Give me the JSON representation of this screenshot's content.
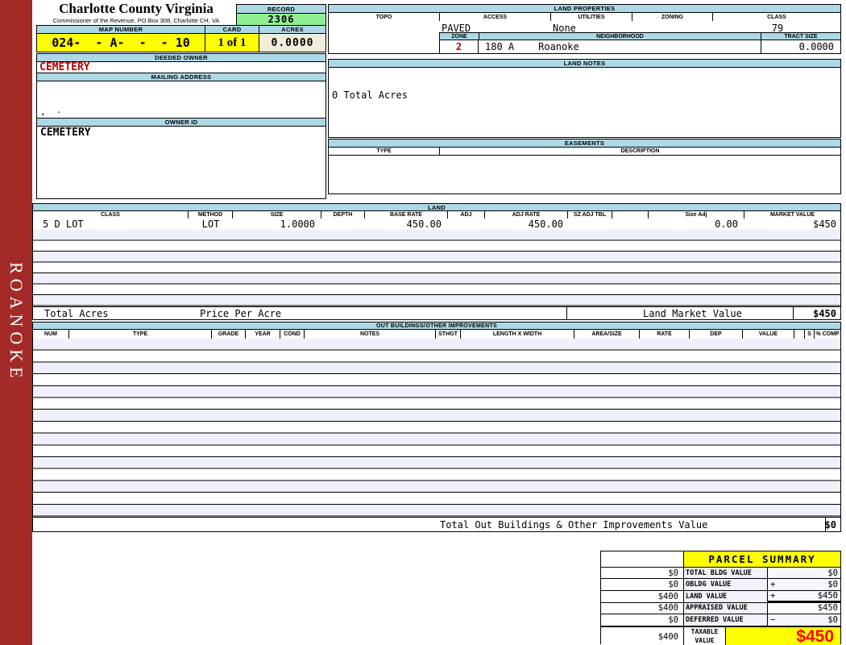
{
  "app": {
    "sidebar_label": "ROANOKE"
  },
  "header": {
    "title": "Charlotte County Virginia",
    "subtitle": "Commissioner of the Revenue, PO Box 308, Charlotte CH, VA",
    "record_label": "RECORD",
    "record_value": "2306",
    "map_number_label": "MAP NUMBER",
    "map_number_value": "024-  - A-  -  - 10",
    "card_label": "CARD",
    "card_value": "1 of 1",
    "acres_label": "ACRES",
    "acres_value": "0.0000"
  },
  "owner_panel": {
    "deeded_owner_label": "DEEDED OWNER",
    "deeded_owner_value": "CEMETERY",
    "mailing_address_label": "MAILING ADDRESS",
    "mailing_address_value": ",  -",
    "owner_id_label": "OWNER ID",
    "owner_id_value": "CEMETERY"
  },
  "land_properties": {
    "title": "LAND PROPERTIES",
    "topo_label": "TOPO",
    "access_label": "ACCESS",
    "utilities_label": "UTILITIES",
    "zoning_label": "ZONING",
    "class_label": "CLASS",
    "topo_value": "",
    "access_value": "PAVED",
    "utilities_value": "None",
    "zoning_value": "",
    "class_value": "79",
    "zone_label": "ZONE",
    "zone_value": "2",
    "neighborhood_label": "NEIGHBORHOOD",
    "neighborhood_code": "180 A",
    "neighborhood_name": "Roanoke",
    "tract_size_label": "TRACT SIZE",
    "tract_size_value": "0.0000"
  },
  "land_notes": {
    "title": "LAND NOTES",
    "note": "0 Total Acres"
  },
  "easements": {
    "title": "EASEMENTS",
    "type_label": "TYPE",
    "description_label": "DESCRIPTION"
  },
  "land_table": {
    "title": "LAND",
    "headers": [
      "CLASS",
      "METHOD",
      "SIZE",
      "DEPTH",
      "BASE RATE",
      "ADJ",
      "ADJ RATE",
      "SZ ADJ TBL",
      "",
      "Size Adj",
      "MARKET VALUE"
    ],
    "row": [
      "5 D LOT",
      "LOT",
      "1.0000",
      "",
      "450.00",
      "",
      "450.00",
      "",
      "",
      "0.00",
      "$450"
    ],
    "totals": {
      "total_acres_label": "Total Acres",
      "price_per_acre_label": "Price Per Acre",
      "land_market_value_label": "Land Market Value",
      "land_market_value": "$450"
    }
  },
  "out_buildings": {
    "title": "OUT BUILDINGS/OTHER IMPROVEMENTS",
    "headers": [
      "NUM",
      "TYPE",
      "GRADE",
      "YEAR",
      "COND",
      "NOTES",
      "STHGT",
      "LENGTH X WIDTH",
      "AREA/SIZE",
      "RATE",
      "DEP",
      "VALUE",
      "",
      "S",
      "% COMP"
    ],
    "total_label": "Total Out Buildings & Other Improvements Value",
    "total_value": "$0"
  },
  "parcel_summary": {
    "title": "PARCEL SUMMARY",
    "rows": [
      {
        "prior": "$0",
        "label": "TOTAL BLDG VALUE",
        "op": "",
        "value": "$0"
      },
      {
        "prior": "$0",
        "label": "OBLDG VALUE",
        "op": "+",
        "value": "$0"
      },
      {
        "prior": "$400",
        "label": "LAND VALUE",
        "op": "+",
        "value": "$450"
      },
      {
        "prior": "$400",
        "label": "APPRAISED VALUE",
        "op": "",
        "value": "$450"
      },
      {
        "prior": "$0",
        "label": "DEFERRED VALUE",
        "op": "−",
        "value": "$0"
      }
    ],
    "taxable_row": {
      "prior": "$400",
      "label": "TAXABLE VALUE",
      "value": "$450"
    }
  },
  "colors": {
    "sidebar_red": "#A32A26",
    "section_header_blue": "#ADD8E6",
    "record_green": "#90EE90",
    "highlight_yellow": "#FFFF00",
    "acres_cream": "#F0EEDB",
    "owner_red": "#C00000",
    "taxable_total_red": "#FF0000"
  }
}
